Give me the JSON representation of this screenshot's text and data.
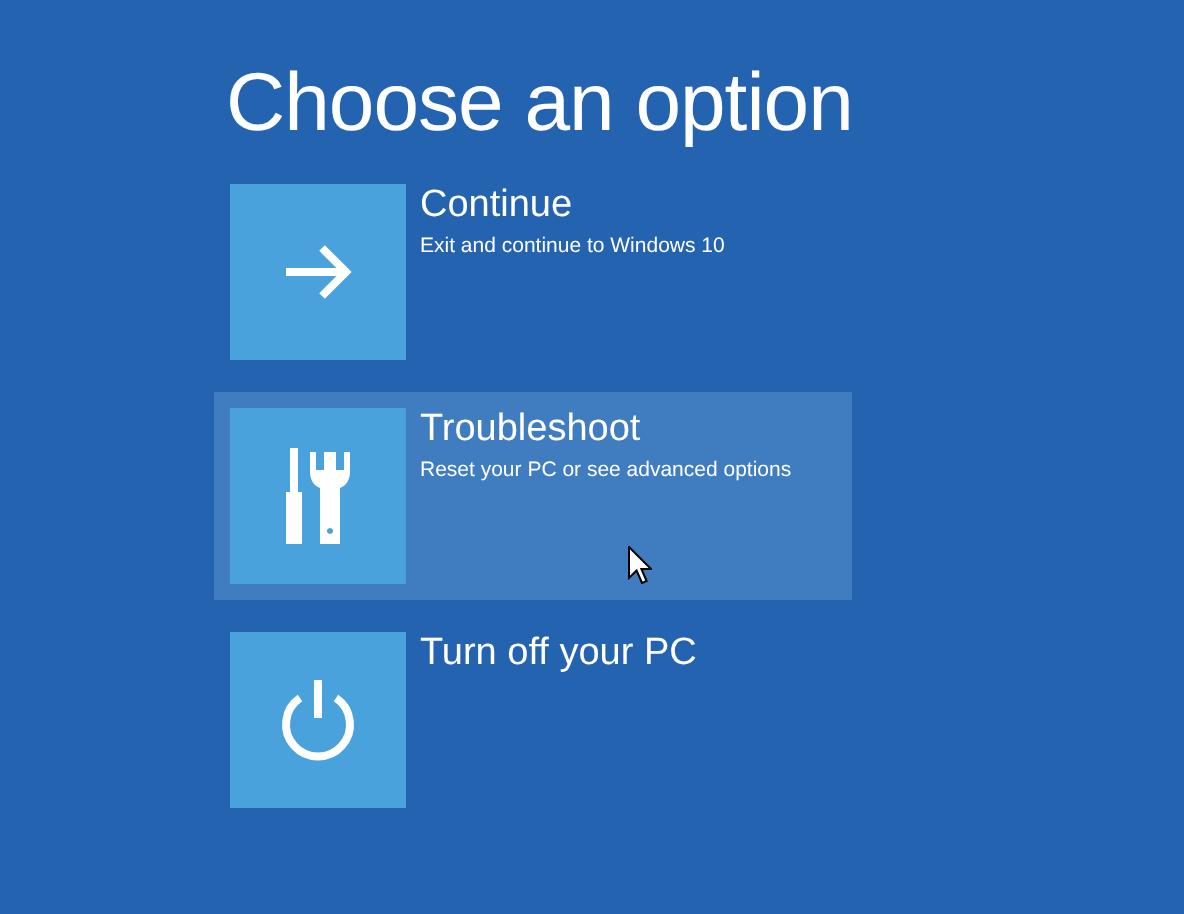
{
  "title": "Choose an option",
  "options": [
    {
      "kind": "continue",
      "label": "Continue",
      "description": "Exit and continue to Windows 10",
      "selected": false
    },
    {
      "kind": "troubleshoot",
      "label": "Troubleshoot",
      "description": "Reset your PC or see advanced options",
      "selected": true
    },
    {
      "kind": "power",
      "label": "Turn off your PC",
      "selected": false
    }
  ]
}
